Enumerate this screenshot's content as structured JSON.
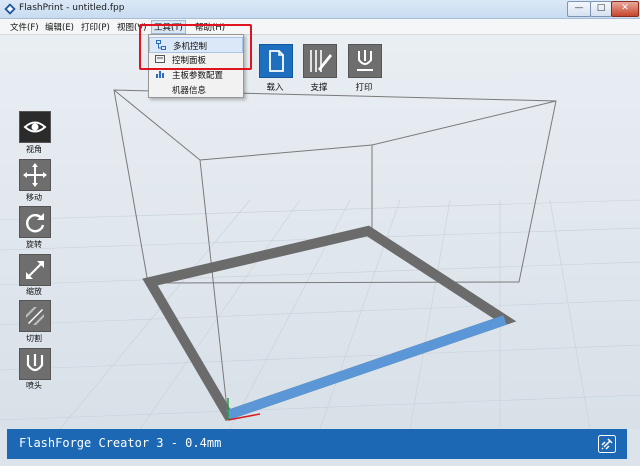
{
  "window": {
    "title": "FlashPrint - untitled.fpp",
    "minimize": "—",
    "maximize": "□",
    "close": "✕"
  },
  "menubar": {
    "items": [
      {
        "label": "文件(F)"
      },
      {
        "label": "编辑(E)"
      },
      {
        "label": "打印(P)"
      },
      {
        "label": "视图(V)"
      },
      {
        "label": "工具(T)"
      },
      {
        "label": "帮助(H)"
      }
    ]
  },
  "tools_menu": {
    "items": [
      {
        "label": "多机控制",
        "icon": "network-icon",
        "highlighted": true
      },
      {
        "label": "控制面板",
        "icon": "panel-icon"
      },
      {
        "label": "主板参数配置",
        "icon": "chart-icon"
      },
      {
        "label": "机器信息",
        "icon": ""
      }
    ]
  },
  "left_toolbar": {
    "items": [
      {
        "label": "视角",
        "icon": "eye-icon",
        "active": true
      },
      {
        "label": "移动",
        "icon": "move-icon"
      },
      {
        "label": "旋转",
        "icon": "rotate-icon"
      },
      {
        "label": "缩放",
        "icon": "scale-icon"
      },
      {
        "label": "切割",
        "icon": "cut-icon"
      },
      {
        "label": "喷头",
        "icon": "nozzle-icon"
      }
    ]
  },
  "top_toolbar": {
    "items": [
      {
        "label": "载入",
        "icon": "load-file-icon",
        "color": "#1e6fc0"
      },
      {
        "label": "支撑",
        "icon": "support-icon"
      },
      {
        "label": "打印",
        "icon": "print-icon"
      }
    ]
  },
  "status": {
    "text": "FlashForge Creator 3 - 0.4mm",
    "icon": "link-icon"
  },
  "colors": {
    "accent": "#1e6fc0",
    "highlight_border": "#e0141e",
    "toolbar_gray": "#6e6e6e"
  }
}
